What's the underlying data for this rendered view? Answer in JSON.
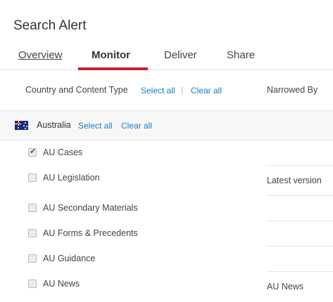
{
  "page": {
    "title": "Search Alert"
  },
  "tabs": [
    {
      "label": "Overview"
    },
    {
      "label": "Monitor"
    },
    {
      "label": "Deliver"
    },
    {
      "label": "Share"
    }
  ],
  "header": {
    "left_title": "Country and Content Type",
    "select_all": "Select all",
    "separator": "|",
    "clear_all": "Clear all",
    "right_title": "Narrowed By"
  },
  "country": {
    "name": "Australia",
    "select_all": "Select all",
    "clear_all": "Clear all",
    "flag_icon": "australia-flag-icon"
  },
  "content_types": [
    {
      "label": "AU Cases",
      "checked": true,
      "narrowed_by": ""
    },
    {
      "label": "AU Legislation",
      "checked": false,
      "narrowed_by": "Latest version"
    },
    {
      "label": "AU Secondary Materials",
      "checked": false,
      "narrowed_by": ""
    },
    {
      "label": "AU Forms & Precedents",
      "checked": false,
      "narrowed_by": ""
    },
    {
      "label": "AU Guidance",
      "checked": false,
      "narrowed_by": ""
    },
    {
      "label": "AU News",
      "checked": false,
      "narrowed_by": "AU News"
    }
  ],
  "colors": {
    "accent": "#c8202f",
    "link": "#1a7bbf"
  }
}
